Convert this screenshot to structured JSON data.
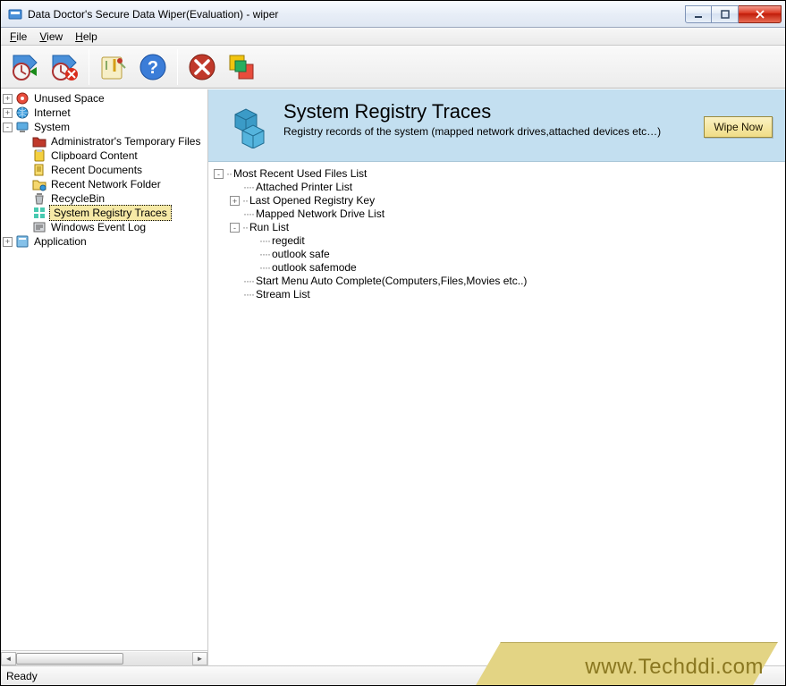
{
  "window": {
    "title": "Data Doctor's Secure Data Wiper(Evaluation) - wiper"
  },
  "menu": {
    "file": "File",
    "view": "View",
    "help": "Help"
  },
  "toolbar": {
    "start_scan": "start-scan",
    "stop_scan": "stop-scan",
    "settings": "settings",
    "help": "help",
    "close": "close",
    "switch": "switch"
  },
  "sidebar": {
    "items": [
      {
        "label": "Unused Space",
        "expander": "+",
        "icon": "drive"
      },
      {
        "label": "Internet",
        "expander": "+",
        "icon": "globe"
      },
      {
        "label": "System",
        "expander": "-",
        "icon": "computer",
        "children": [
          {
            "label": "Administrator's Temporary Files",
            "icon": "folder-red"
          },
          {
            "label": "Clipboard Content",
            "icon": "clipboard"
          },
          {
            "label": "Recent Documents",
            "icon": "recent-doc"
          },
          {
            "label": "Recent Network Folder",
            "icon": "network-folder"
          },
          {
            "label": "RecycleBin",
            "icon": "recyclebin"
          },
          {
            "label": "System Registry Traces",
            "icon": "registry"
          },
          {
            "label": "Windows Event Log",
            "icon": "event-log"
          }
        ]
      },
      {
        "label": "Application",
        "expander": "+",
        "icon": "app"
      }
    ],
    "selectedPath": "System > System Registry Traces"
  },
  "content": {
    "heading": "System Registry Traces",
    "description": "Registry records of the system (mapped network drives,attached devices etc…)",
    "button": "Wipe Now"
  },
  "detail": {
    "root": {
      "label": "Most Recent Used Files List",
      "expander": "-"
    },
    "items": [
      {
        "label": "Attached Printer List",
        "depth": 1
      },
      {
        "label": "Last Opened Registry Key",
        "depth": 1,
        "expander": "+"
      },
      {
        "label": "Mapped Network Drive List",
        "depth": 1
      },
      {
        "label": "Run List",
        "depth": 1,
        "expander": "-"
      },
      {
        "label": "regedit",
        "depth": 2
      },
      {
        "label": "outlook safe",
        "depth": 2
      },
      {
        "label": "outlook safemode",
        "depth": 2
      },
      {
        "label": "Start Menu Auto Complete(Computers,Files,Movies etc..)",
        "depth": 1
      },
      {
        "label": "Stream List",
        "depth": 1
      }
    ]
  },
  "status": {
    "text": "Ready"
  },
  "watermark": {
    "text": "www.Techddi.com"
  }
}
